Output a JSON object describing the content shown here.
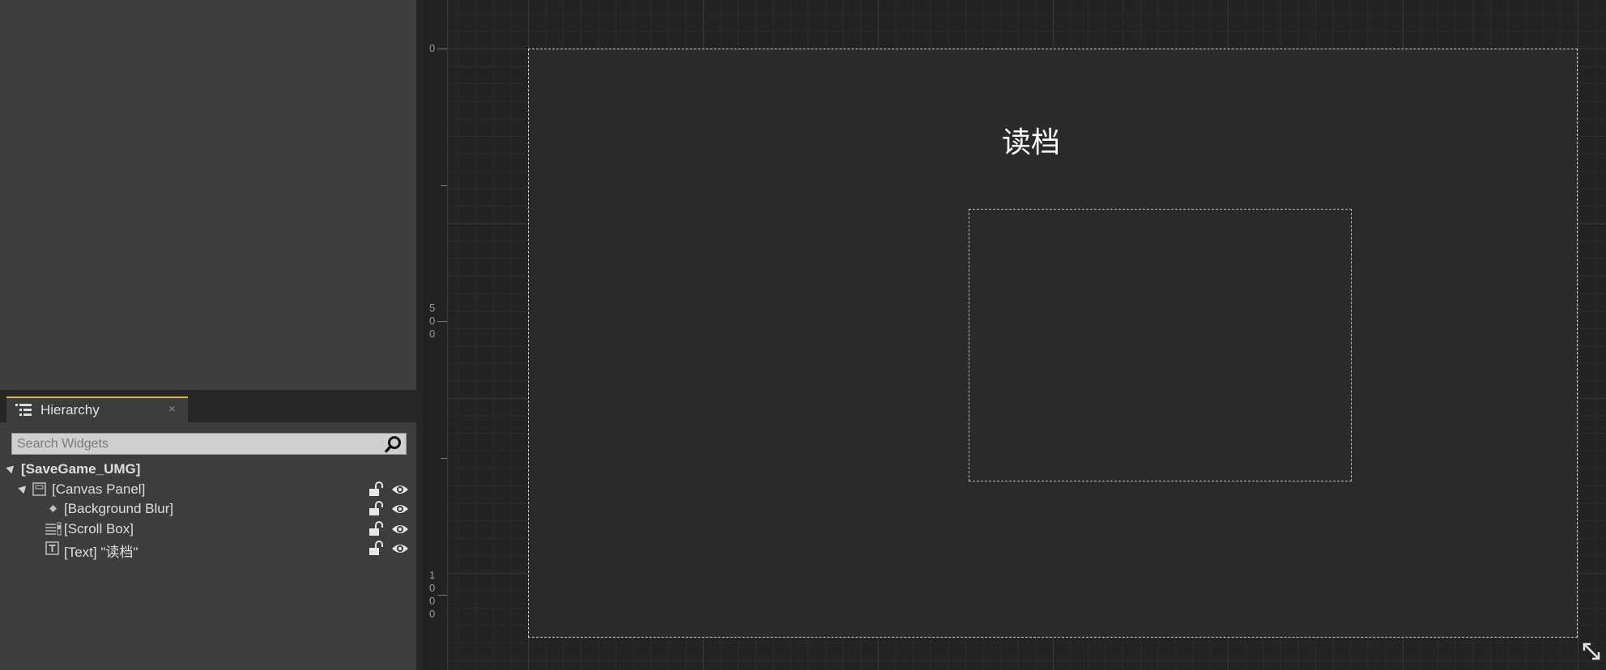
{
  "hierarchy": {
    "tab_label": "Hierarchy",
    "tab_close": "×",
    "search_placeholder": "Search Widgets",
    "root": "[SaveGame_UMG]",
    "items": [
      {
        "label": "[Canvas Panel]"
      },
      {
        "label": "[Background Blur]"
      },
      {
        "label": "[Scroll Box]"
      },
      {
        "label": "[Text] \"读档\""
      }
    ]
  },
  "viewport": {
    "title_text": "读档",
    "ruler": {
      "zero": "0",
      "five_hundred": [
        "5",
        "0",
        "0"
      ],
      "one_thousand": [
        "1",
        "0",
        "0",
        "0"
      ]
    }
  },
  "colors": {
    "tab_accent": "#d6b84a",
    "canvas_bg": "#2a2a2a",
    "grid_major": "#383838",
    "grid_minor": "#2c2c2c"
  },
  "icons": {
    "hierarchy": "list-tree-icon",
    "search": "magnifier-icon",
    "lock": "unlocked-padlock-icon",
    "visibility": "eye-icon",
    "resize": "diagonal-resize-icon"
  }
}
